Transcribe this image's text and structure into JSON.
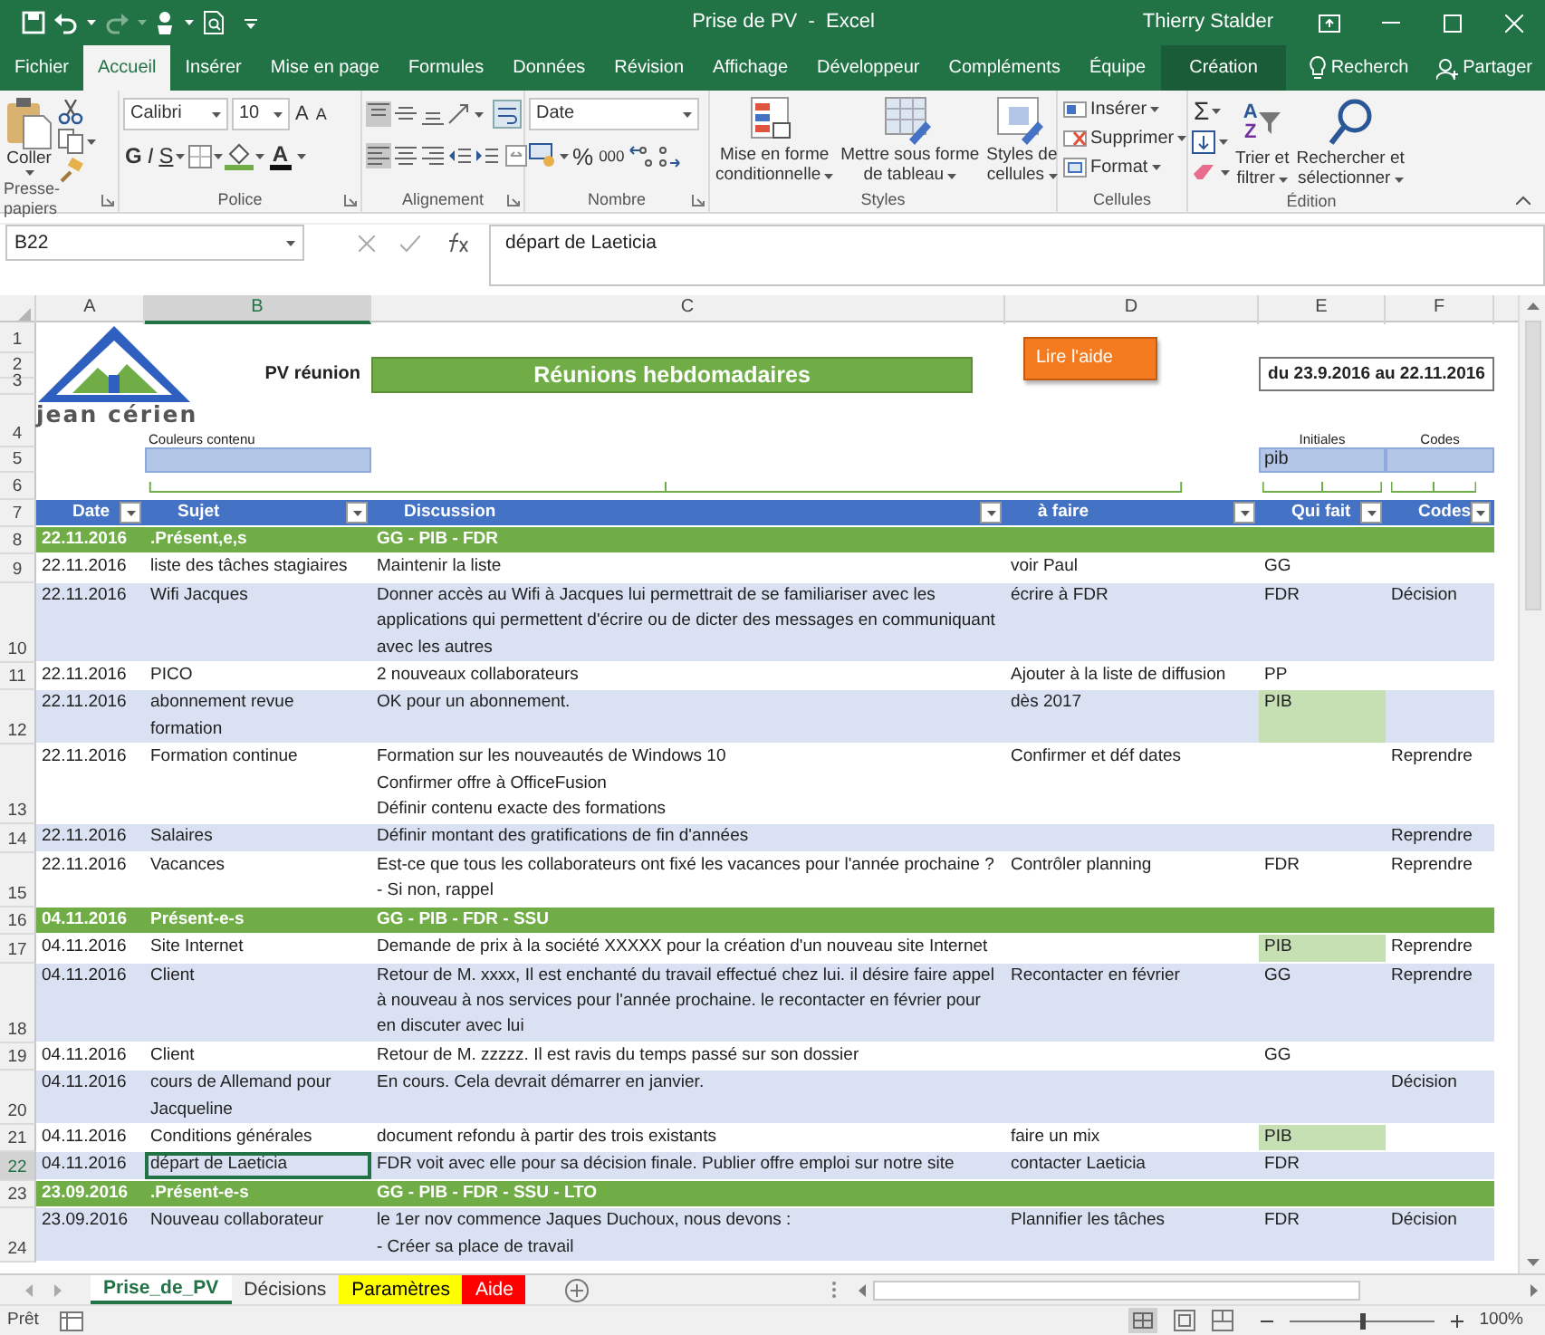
{
  "title_bar": {
    "title": "Prise de PV  -  Excel",
    "user": "Thierry Stalder"
  },
  "ribbon_tabs": [
    {
      "label": "Fichier",
      "kind": "file",
      "selected": false
    },
    {
      "label": "Accueil",
      "kind": "tab",
      "selected": true
    },
    {
      "label": "Insérer",
      "kind": "tab",
      "selected": false
    },
    {
      "label": "Mise en page",
      "kind": "tab",
      "selected": false
    },
    {
      "label": "Formules",
      "kind": "tab",
      "selected": false
    },
    {
      "label": "Données",
      "kind": "tab",
      "selected": false
    },
    {
      "label": "Révision",
      "kind": "tab",
      "selected": false
    },
    {
      "label": "Affichage",
      "kind": "tab",
      "selected": false
    },
    {
      "label": "Développeur",
      "kind": "tab",
      "selected": false
    },
    {
      "label": "Compléments",
      "kind": "tab",
      "selected": false
    },
    {
      "label": "Équipe",
      "kind": "tab",
      "selected": false
    },
    {
      "label": "Création",
      "kind": "contextual",
      "selected": false
    }
  ],
  "tell_me": "Recherch",
  "share": "Partager",
  "clipboard": {
    "paste": "Coller",
    "group": "Presse-papiers"
  },
  "font": {
    "name": "Calibri",
    "size": "10",
    "grow": "A",
    "shrink": "A",
    "bold": "G",
    "italic": "I",
    "underline": "S",
    "color_letter": "A",
    "group": "Police"
  },
  "alignment": {
    "vertical": [
      {
        "selected": true
      },
      {
        "selected": false
      },
      {
        "selected": false
      }
    ],
    "horizontal": [
      {
        "selected": true
      },
      {
        "selected": false
      },
      {
        "selected": false
      }
    ],
    "group": "Alignement"
  },
  "number": {
    "format": "Date",
    "percent": "%",
    "thousands": "000",
    "group": "Nombre"
  },
  "styles": {
    "buttons": [
      {
        "lines": [
          "Mise en forme",
          "conditionnelle"
        ]
      },
      {
        "lines": [
          "Mettre sous forme",
          "de tableau"
        ]
      },
      {
        "lines": [
          "Styles de",
          "cellules"
        ]
      }
    ],
    "group": "Styles"
  },
  "cells": {
    "buttons": [
      "Insérer",
      "Supprimer",
      "Format"
    ],
    "group": "Cellules"
  },
  "editing": {
    "sum": "Σ",
    "sort_letters": [
      "A",
      "Z"
    ],
    "buttons": [
      {
        "lines": [
          "Trier et",
          "filtrer"
        ]
      },
      {
        "lines": [
          "Rechercher et",
          "sélectionner"
        ]
      }
    ],
    "group": "Édition"
  },
  "formula_bar": {
    "name_box": "B22",
    "content": "départ de Laeticia"
  },
  "columns": [
    {
      "label": "A",
      "selected": false
    },
    {
      "label": "B",
      "selected": true
    },
    {
      "label": "C",
      "selected": false
    },
    {
      "label": "D",
      "selected": false
    },
    {
      "label": "E",
      "selected": false
    },
    {
      "label": "F",
      "selected": false
    }
  ],
  "top_rows": [
    "1",
    "2",
    "3",
    "4",
    "5",
    "6"
  ],
  "sheet_header": {
    "logo_text": "jean cérien",
    "label": "PV réunion",
    "title": "Réunions hebdomadaires",
    "help_button": "Lire l'aide",
    "period": "du 23.9.2016 au 22.11.2016",
    "colors_label": "Couleurs contenu",
    "initials_label": "Initiales",
    "codes_label": "Codes",
    "initials_value": "pib"
  },
  "table": {
    "row": "7",
    "columns": [
      "Date",
      "Sujet",
      "Discussion",
      "à faire",
      "Qui fait",
      "Codes"
    ],
    "rows": [
      {
        "row": "8",
        "kind": "group",
        "date": "22.11.2016",
        "subject": ".Présent,e,s",
        "discussion": "GG - PIB - FDR"
      },
      {
        "row": "9",
        "kind": "item",
        "date": "22.11.2016",
        "subject": "liste des tâches stagiaires",
        "discussion": "Maintenir la liste",
        "todo": "voir Paul",
        "who": "GG",
        "who_highlighted": false,
        "selected": false
      },
      {
        "row": "10",
        "kind": "item",
        "date": "22.11.2016",
        "subject": "Wifi Jacques",
        "discussion": "Donner accès au Wifi à Jacques lui permettrait de se familiariser avec les applications qui permettent d'écrire ou de dicter des messages en communiquant  avec les autres",
        "todo": "écrire à  FDR",
        "who": "FDR",
        "code": "Décision",
        "who_highlighted": false,
        "selected": false
      },
      {
        "row": "11",
        "kind": "item",
        "date": "22.11.2016",
        "subject": "PICO",
        "discussion": "2 nouveaux collaborateurs",
        "todo": "Ajouter à la liste de diffusion",
        "who": "PP",
        "who_highlighted": false,
        "selected": false
      },
      {
        "row": "12",
        "kind": "item",
        "date": "22.11.2016",
        "subject": "abonnement revue formation",
        "discussion": "OK pour un abonnement.",
        "todo": "dès 2017",
        "who": "PIB",
        "who_highlighted": true,
        "selected": false
      },
      {
        "row": "13",
        "kind": "item",
        "date": "22.11.2016",
        "subject": "Formation continue",
        "discussion": "Formation sur les nouveautés de Windows 10\nConfirmer offre à OfficeFusion\nDéfinir contenu exacte des formations",
        "todo": "Confirmer et déf dates",
        "code": "Reprendre",
        "who_highlighted": false,
        "selected": false
      },
      {
        "row": "14",
        "kind": "item",
        "date": "22.11.2016",
        "subject": "Salaires",
        "discussion": "Définir montant des gratifications de fin d'années",
        "code": "Reprendre",
        "who_highlighted": false,
        "selected": false
      },
      {
        "row": "15",
        "kind": "item",
        "date": "22.11.2016",
        "subject": "Vacances",
        "discussion": "Est-ce que tous les collaborateurs ont fixé les vacances pour l'année prochaine ?\n- Si non, rappel",
        "todo": "Contrôler planning",
        "who": "FDR",
        "code": "Reprendre",
        "who_highlighted": false,
        "selected": false
      },
      {
        "row": "16",
        "kind": "group",
        "date": "04.11.2016",
        "subject": "Présent-e-s",
        "discussion": "GG - PIB - FDR - SSU"
      },
      {
        "row": "17",
        "kind": "item",
        "date": "04.11.2016",
        "subject": "Site Internet",
        "discussion": "Demande de prix à la société XXXXX pour la création d'un nouveau site Internet",
        "who": "PIB",
        "code": "Reprendre",
        "who_highlighted": true,
        "selected": false
      },
      {
        "row": "18",
        "kind": "item",
        "date": "04.11.2016",
        "subject": "Client",
        "discussion": "Retour de M. xxxx, Il est enchanté du travail effectué chez lui. il désire faire appel à nouveau à nos services pour l'année prochaine. le recontacter en février pour en discuter avec lui",
        "todo": "Recontacter en février",
        "who": "GG",
        "code": "Reprendre",
        "who_highlighted": false,
        "selected": false
      },
      {
        "row": "19",
        "kind": "item",
        "date": "04.11.2016",
        "subject": "Client",
        "discussion": "Retour de M. zzzzz. Il est ravis du temps passé sur son dossier",
        "who": "GG",
        "who_highlighted": false,
        "selected": false
      },
      {
        "row": "20",
        "kind": "item",
        "date": "04.11.2016",
        "subject": "cours de Allemand pour Jacqueline",
        "discussion": "En cours. Cela devrait démarrer en janvier.",
        "code": "Décision",
        "who_highlighted": false,
        "selected": false
      },
      {
        "row": "21",
        "kind": "item",
        "date": "04.11.2016",
        "subject": "Conditions générales",
        "discussion": "document refondu à partir des trois existants",
        "todo": "faire un mix",
        "who": "PIB",
        "who_highlighted": true,
        "selected": false
      },
      {
        "row": "22",
        "kind": "item",
        "date": "04.11.2016",
        "subject": "départ de Laeticia",
        "discussion": "FDR voit avec elle pour sa décision finale. Publier offre emploi sur notre site",
        "todo": "contacter Laeticia",
        "who": "FDR",
        "who_highlighted": false,
        "selected": true
      },
      {
        "row": "23",
        "kind": "group",
        "date": "23.09.2016",
        "subject": ".Présent-e-s",
        "discussion": "GG - PIB - FDR - SSU - LTO"
      },
      {
        "row": "24",
        "kind": "item",
        "date": "23.09.2016",
        "subject": "Nouveau collaborateur",
        "discussion": "le 1er nov commence Jaques Duchoux, nous devons :\n- Créer sa place de travail",
        "todo": "Plannifier les tâches",
        "who": "FDR",
        "code": "Décision",
        "who_highlighted": false,
        "selected": false
      }
    ]
  },
  "sheet_tabs": [
    {
      "label": "Prise_de_PV",
      "selected": true
    },
    {
      "label": "Décisions",
      "selected": false
    },
    {
      "label": "Paramètres",
      "selected": false,
      "color": "#ffff00"
    },
    {
      "label": "Aide",
      "selected": false,
      "color": "#ff0000"
    }
  ],
  "status": {
    "text": "Prêt",
    "zoom": "100%",
    "zoom_slider": {
      "level": 0.5
    }
  }
}
